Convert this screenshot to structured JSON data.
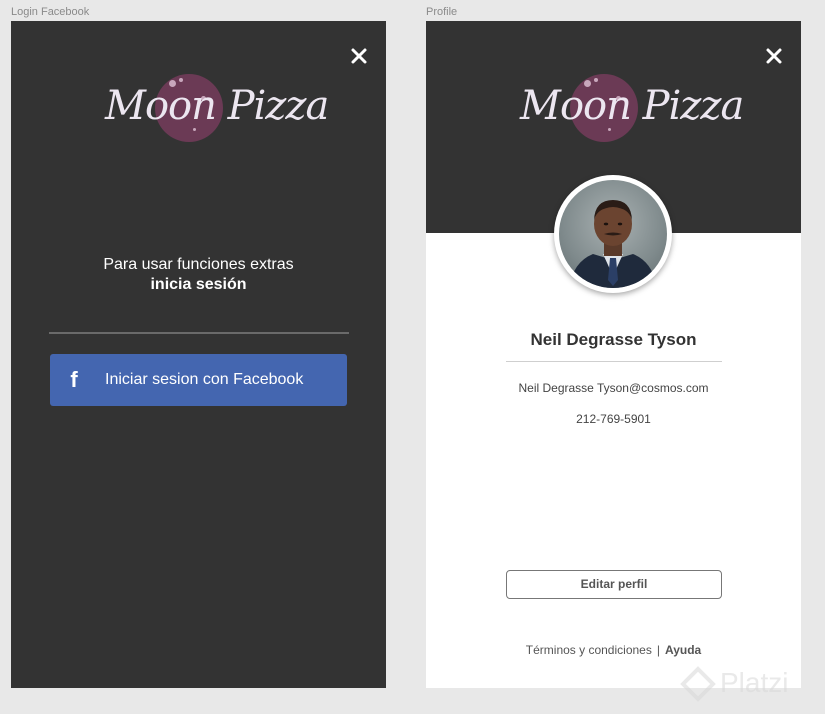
{
  "frames": {
    "login_label": "Login Facebook",
    "profile_label": "Profile"
  },
  "brand": {
    "logo_text": "Moon Pizza",
    "moon_color": "#6b3a55",
    "header_color": "#333333"
  },
  "login": {
    "prompt_line1": "Para usar funciones extras",
    "prompt_line2": "inicia sesión",
    "facebook_button_label": "Iniciar sesion con Facebook",
    "facebook_icon": "f",
    "facebook_color": "#4466b0",
    "close_icon": "close-icon"
  },
  "profile": {
    "name": "Neil Degrasse Tyson",
    "email": "Neil Degrasse Tyson@cosmos.com",
    "phone": "212-769-5901",
    "edit_button_label": "Editar perfil",
    "footer": {
      "terms": "Términos y condiciones",
      "separator": "|",
      "help": "Ayuda"
    },
    "close_icon": "close-icon"
  },
  "watermark": {
    "text": "Platzi"
  }
}
